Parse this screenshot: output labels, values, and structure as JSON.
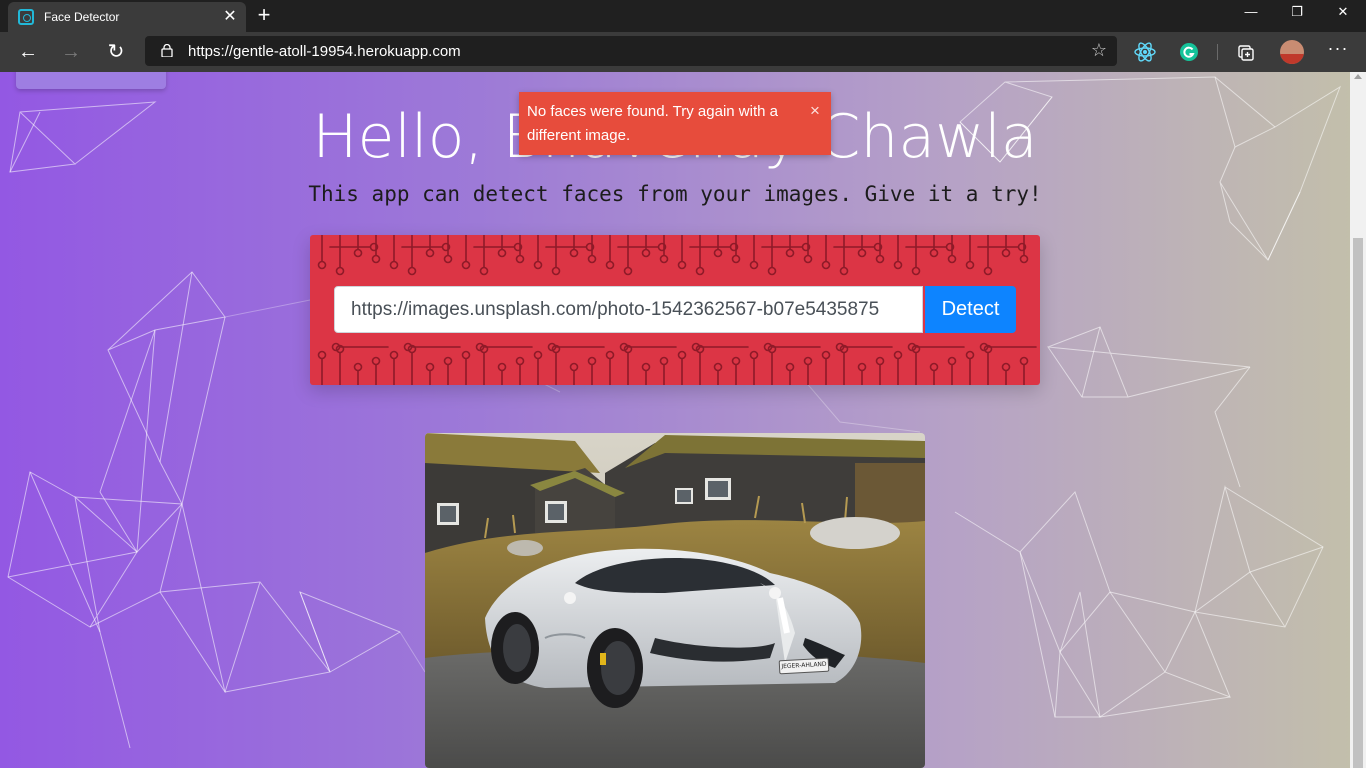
{
  "browser": {
    "tab_title": "Face Detector",
    "tab_close": "✕",
    "new_tab": "+",
    "url": "https://gentle-atoll-19954.herokuapp.com",
    "window_controls": {
      "minimize": "—",
      "restore": "❐",
      "close": "✕"
    },
    "nav": {
      "back": "←",
      "forward": "→",
      "reload": "↻"
    },
    "favorite": "☆",
    "more": "···",
    "extensions": [
      "react-devtools-icon",
      "grammarly-icon",
      "collections-icon"
    ]
  },
  "page": {
    "title": "Hello, Bhavenay Chawla",
    "subtitle": "This app can detect faces from your images. Give it a try!",
    "toast": {
      "message": "No faces were found. Try again with a different image.",
      "close": "×"
    },
    "form": {
      "input_value": "https://images.unsplash.com/photo-1542362567-b07e5435875",
      "button_label": "Detect"
    },
    "image": {
      "plate_text": "JEGER-AHLAND"
    }
  },
  "colors": {
    "toast": "#e74c3c",
    "circuit_card": "#dc3545",
    "detect_button": "#0d84ff",
    "gradient_start": "#9358e3",
    "gradient_end": "#c3c0aa"
  }
}
